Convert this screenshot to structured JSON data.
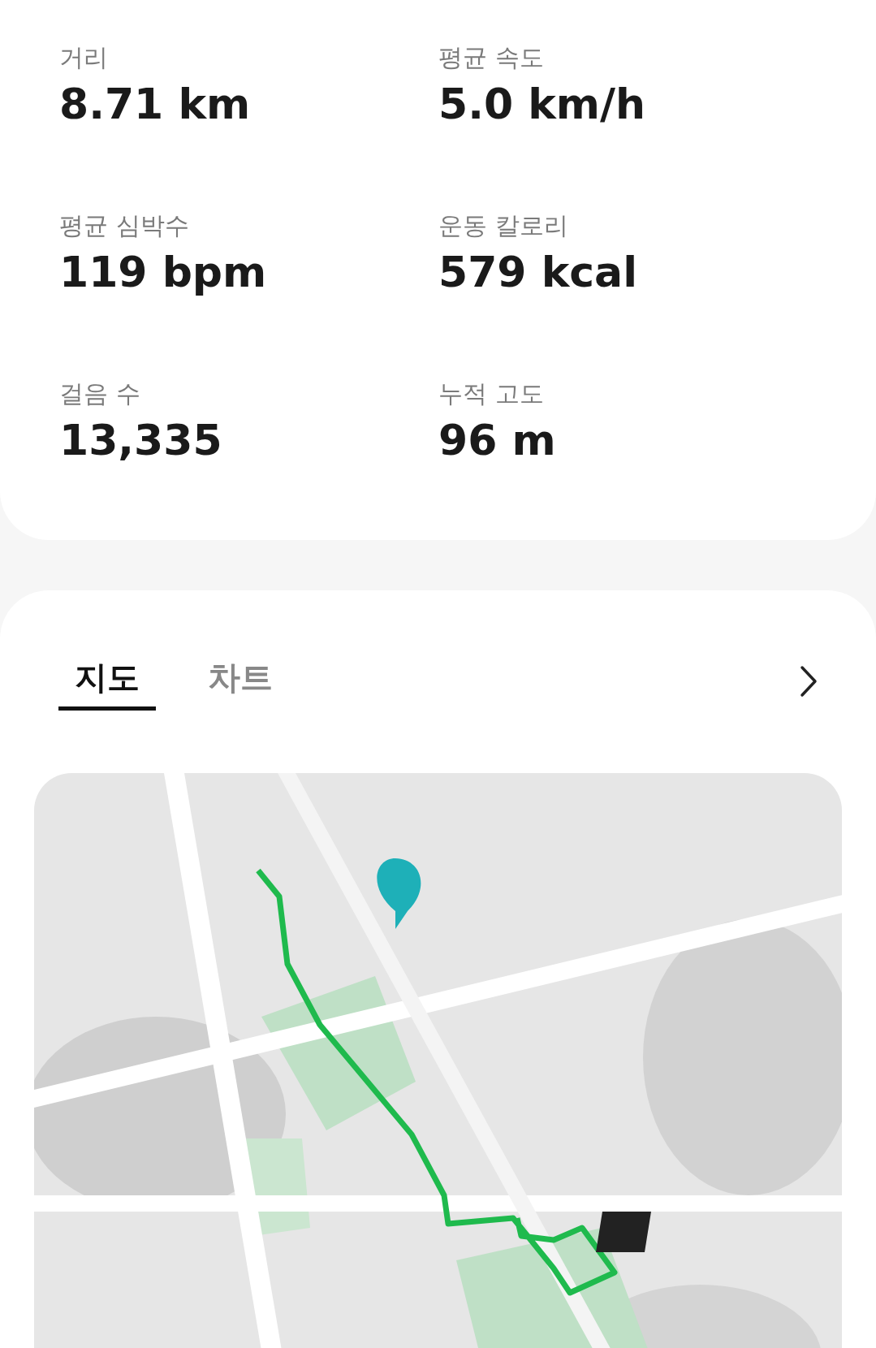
{
  "stats": [
    {
      "label": "거리",
      "value": "8.71 km"
    },
    {
      "label": "평균 속도",
      "value": "5.0 km/h"
    },
    {
      "label": "평균 심박수",
      "value": "119 bpm"
    },
    {
      "label": "운동 칼로리",
      "value": "579 kcal"
    },
    {
      "label": "걸음 수",
      "value": "13,335"
    },
    {
      "label": "누적 고도",
      "value": "96 m"
    }
  ],
  "tabs": [
    {
      "label": "지도",
      "selected": true
    },
    {
      "label": "차트",
      "selected": false
    }
  ]
}
